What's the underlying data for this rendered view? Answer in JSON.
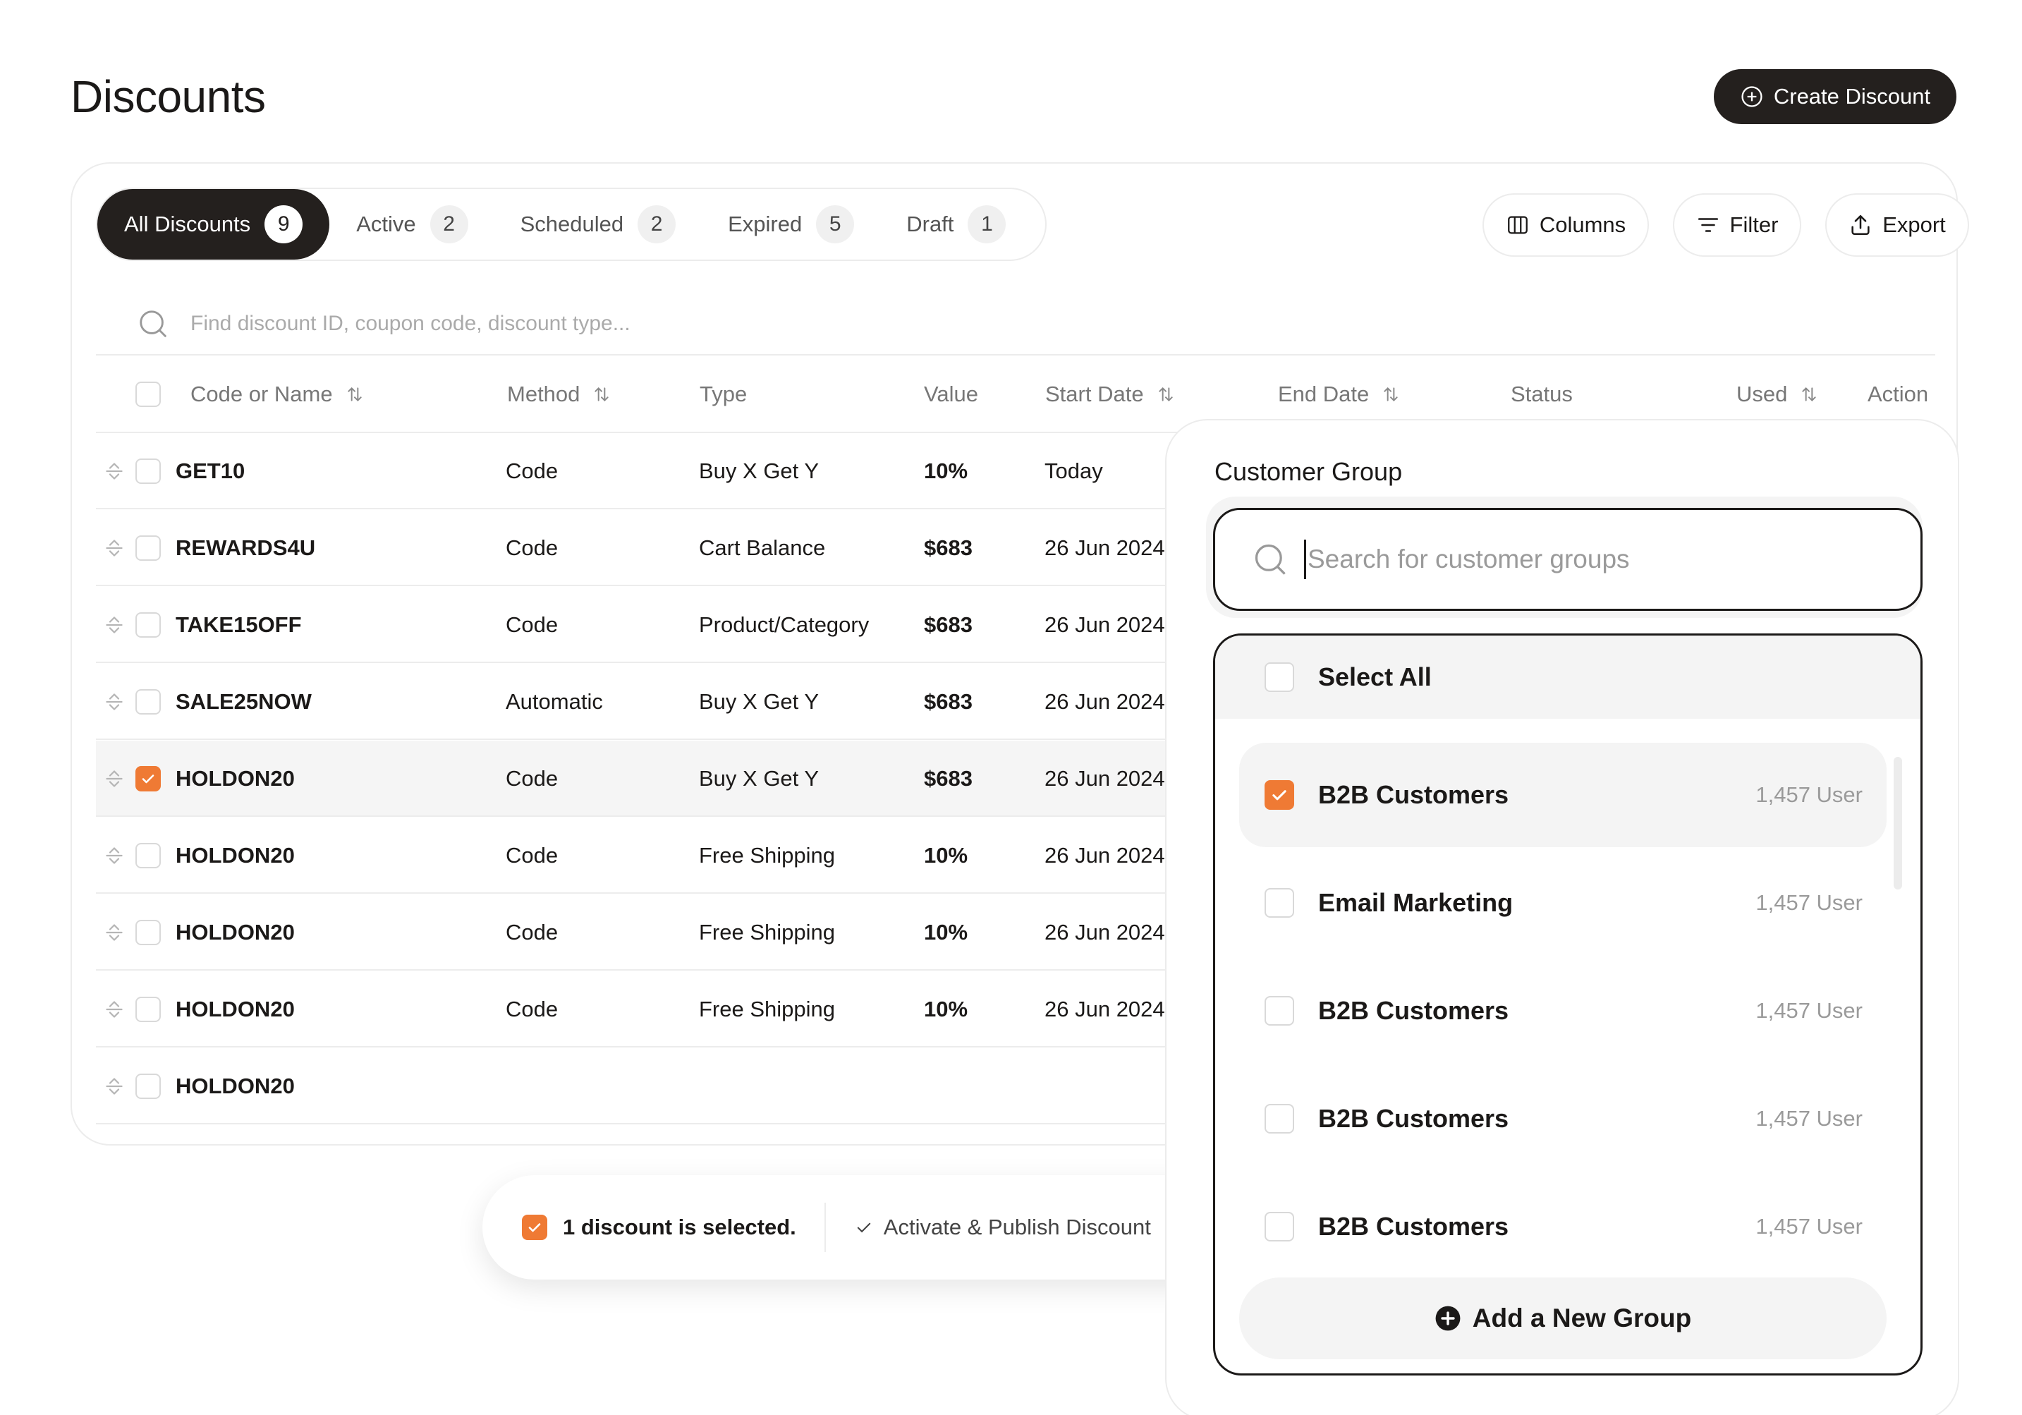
{
  "page": {
    "title": "Discounts",
    "create_label": "Create Discount"
  },
  "tabs": [
    {
      "label": "All Discounts",
      "count": "9"
    },
    {
      "label": "Active",
      "count": "2"
    },
    {
      "label": "Scheduled",
      "count": "2"
    },
    {
      "label": "Expired",
      "count": "5"
    },
    {
      "label": "Draft",
      "count": "1"
    }
  ],
  "toolbar": {
    "columns_label": "Columns",
    "filter_label": "Filter",
    "export_label": "Export"
  },
  "search": {
    "placeholder": "Find discount ID, coupon code, discount type..."
  },
  "table": {
    "headers": {
      "code": "Code or Name",
      "method": "Method",
      "type": "Type",
      "value": "Value",
      "start": "Start Date",
      "end": "End Date",
      "status": "Status",
      "used": "Used",
      "action": "Action"
    },
    "rows": [
      {
        "code": "GET10",
        "method": "Code",
        "type": "Buy X Get Y",
        "value": "10%",
        "start": "Today",
        "checked": false
      },
      {
        "code": "REWARDS4U",
        "method": "Code",
        "type": "Cart Balance",
        "value": "$683",
        "start": "26 Jun 2024",
        "checked": false
      },
      {
        "code": "TAKE15OFF",
        "method": "Code",
        "type": "Product/Category",
        "value": "$683",
        "start": "26 Jun 2024",
        "checked": false
      },
      {
        "code": "SALE25NOW",
        "method": "Automatic",
        "type": "Buy X Get Y",
        "value": "$683",
        "start": "26 Jun 2024",
        "checked": false
      },
      {
        "code": "HOLDON20",
        "method": "Code",
        "type": "Buy X Get Y",
        "value": "$683",
        "start": "26 Jun 2024",
        "checked": true
      },
      {
        "code": "HOLDON20",
        "method": "Code",
        "type": "Free Shipping",
        "value": "10%",
        "start": "26 Jun 2024",
        "checked": false
      },
      {
        "code": "HOLDON20",
        "method": "Code",
        "type": "Free Shipping",
        "value": "10%",
        "start": "26 Jun 2024",
        "checked": false
      },
      {
        "code": "HOLDON20",
        "method": "Code",
        "type": "Free Shipping",
        "value": "10%",
        "start": "26 Jun 2024",
        "checked": false
      },
      {
        "code": "HOLDON20",
        "method": "",
        "type": "",
        "value": "",
        "start": "",
        "checked": false
      }
    ]
  },
  "action_bar": {
    "selected_text": "1 discount is selected.",
    "activate_label": "Activate & Publish Discount"
  },
  "customer_group": {
    "title": "Customer Group",
    "search_placeholder": "Search for customer groups",
    "select_all": "Select All",
    "groups": [
      {
        "name": "B2B Customers",
        "count": "1,457 User",
        "checked": true
      },
      {
        "name": "Email Marketing",
        "count": "1,457 User",
        "checked": false
      },
      {
        "name": "B2B Customers",
        "count": "1,457 User",
        "checked": false
      },
      {
        "name": "B2B Customers",
        "count": "1,457 User",
        "checked": false
      },
      {
        "name": "B2B Customers",
        "count": "1,457 User",
        "checked": false
      }
    ],
    "add_label": "Add a New Group"
  },
  "colors": {
    "accent": "#ef7a34",
    "dark": "#24201e",
    "border": "#ececec"
  },
  "icons": [
    "plus-circle-icon",
    "columns-icon",
    "filter-icon",
    "export-icon",
    "search-icon",
    "sort-icon",
    "drag-handle-icon",
    "check-icon",
    "plus-circle-filled-icon"
  ]
}
